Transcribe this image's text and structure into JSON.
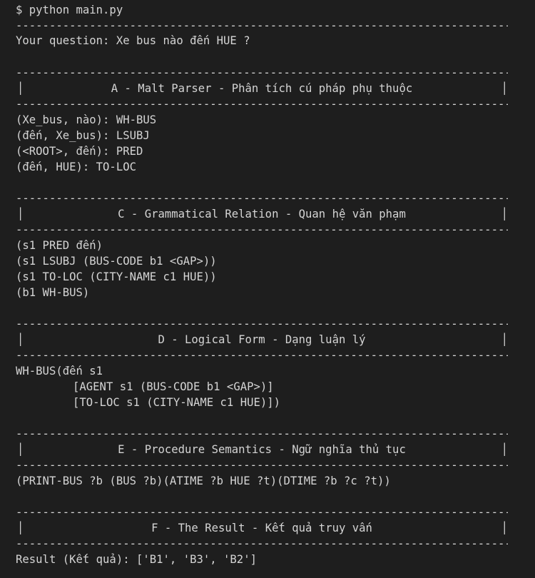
{
  "command": "$ python main.py",
  "question_line": "Your question: Xe bus nào đến HUE ?",
  "sections": {
    "A": {
      "title": "A - Malt Parser - Phân tích cú pháp phụ thuộc",
      "lines": [
        "(Xe_bus, nào): WH-BUS",
        "(đến, Xe_bus): LSUBJ",
        "(<ROOT>, đến): PRED",
        "(đến, HUE): TO-LOC"
      ]
    },
    "C": {
      "title": "C - Grammatical Relation - Quan hệ văn phạm",
      "lines": [
        "(s1 PRED đến)",
        "(s1 LSUBJ (BUS-CODE b1 <GAP>))",
        "(s1 TO-LOC (CITY-NAME c1 HUE))",
        "(b1 WH-BUS)"
      ]
    },
    "D": {
      "title": "D - Logical Form - Dạng luận lý",
      "lines": [
        "WH-BUS(đến s1",
        "[AGENT s1 (BUS-CODE b1 <GAP>)]",
        "[TO-LOC s1 (CITY-NAME c1 HUE)])"
      ]
    },
    "E": {
      "title": "E - Procedure Semantics - Ngữ nghĩa thủ tục",
      "lines": [
        "(PRINT-BUS ?b (BUS ?b)(ATIME ?b HUE ?t)(DTIME ?b ?c ?t))"
      ]
    },
    "F": {
      "title": "F - The Result - Kết quả truy vấn",
      "lines": [
        "Result (Kết quả): ['B1', 'B3', 'B2']"
      ]
    }
  },
  "colors": {
    "background": "#1e1e1e",
    "foreground": "#d4d4d4"
  }
}
